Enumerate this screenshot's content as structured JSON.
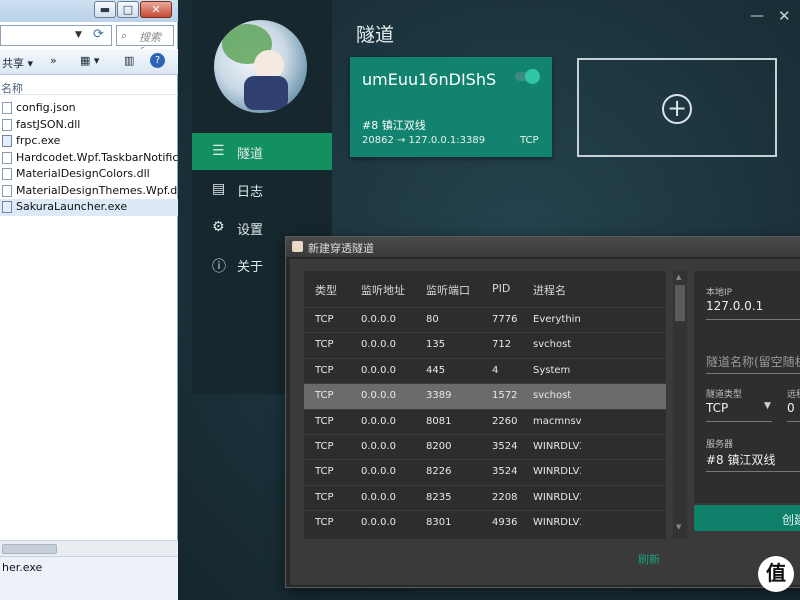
{
  "explorer": {
    "title_buttons": {
      "minimize": "▬",
      "maximize": "□",
      "close": "✕"
    },
    "search_placeholder": "搜索 frp",
    "toolbar": {
      "share": "共享 ▾",
      "more": "»",
      "view": "▦ ▾",
      "panes": "▥",
      "help": "?"
    },
    "column_name": "名称",
    "files": [
      {
        "name": "config.json",
        "type": "json"
      },
      {
        "name": "fastJSON.dll",
        "type": "dll"
      },
      {
        "name": "frpc.exe",
        "type": "exe"
      },
      {
        "name": "Hardcodet.Wpf.TaskbarNotification",
        "type": "dll"
      },
      {
        "name": "MaterialDesignColors.dll",
        "type": "dll"
      },
      {
        "name": "MaterialDesignThemes.Wpf.dll",
        "type": "dll"
      },
      {
        "name": "SakuraLauncher.exe",
        "type": "exe",
        "selected": true
      }
    ],
    "status_text": "her.exe"
  },
  "launcher": {
    "title": "隧道",
    "window_controls": {
      "minimize": "—",
      "close": "✕"
    },
    "nav": [
      {
        "label": "隧道",
        "icon": "server-icon",
        "glyph": "☰",
        "active": true
      },
      {
        "label": "日志",
        "icon": "log-icon",
        "glyph": "▤"
      },
      {
        "label": "设置",
        "icon": "gear-icon",
        "glyph": "⚙"
      },
      {
        "label": "关于",
        "icon": "info-icon",
        "glyph": "ⓘ"
      }
    ],
    "tunnel_card": {
      "name": "umEuu16nDIShS",
      "enabled": true,
      "node": "#8 镇江双线",
      "mapping": "20862 → 127.0.0.1:3389",
      "protocol": "TCP"
    },
    "add_card_icon": "+"
  },
  "dialog": {
    "title": "新建穿透隧道",
    "table": {
      "columns": [
        "类型",
        "监听地址",
        "监听端口",
        "PID",
        "进程名"
      ],
      "rows": [
        [
          "TCP",
          "0.0.0.0",
          "80",
          "7776",
          "Everything"
        ],
        [
          "TCP",
          "0.0.0.0",
          "135",
          "712",
          "svchost"
        ],
        [
          "TCP",
          "0.0.0.0",
          "445",
          "4",
          "System"
        ],
        [
          "TCP",
          "0.0.0.0",
          "3389",
          "1572",
          "svchost"
        ],
        [
          "TCP",
          "0.0.0.0",
          "8081",
          "2260",
          "macmnsvc"
        ],
        [
          "TCP",
          "0.0.0.0",
          "8200",
          "3524",
          "WINRDLV3"
        ],
        [
          "TCP",
          "0.0.0.0",
          "8226",
          "3524",
          "WINRDLV3"
        ],
        [
          "TCP",
          "0.0.0.0",
          "8235",
          "2208",
          "WINRDLV3"
        ],
        [
          "TCP",
          "0.0.0.0",
          "8301",
          "4936",
          "WINRDLV3"
        ]
      ],
      "selected_row": 3
    },
    "refresh_label": "刷新",
    "form": {
      "local_ip_label": "本地IP",
      "local_ip_value": "127.0.0.1",
      "tunnel_name_placeholder": "隧道名称(留空随机",
      "tunnel_type_label": "隧道类型",
      "tunnel_type_value": "TCP",
      "remote_port_label": "远程",
      "remote_port_value": "0",
      "server_label": "服务器",
      "server_value": "#8 镇江双线"
    },
    "create_label": "创建"
  },
  "watermark": "值"
}
